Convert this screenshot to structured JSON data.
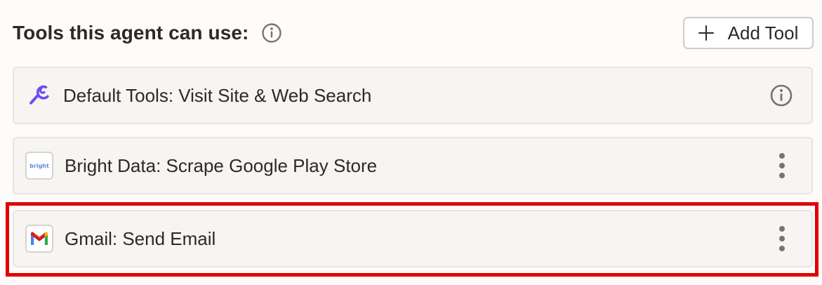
{
  "header": {
    "title": "Tools this agent can use:",
    "info_icon": "info-icon",
    "add_tool_label": "Add Tool"
  },
  "tools": [
    {
      "label": "Default Tools: Visit Site & Web Search",
      "icon": "wrench-icon",
      "action_icon": "info-icon",
      "icon_color": "#6b4cf5"
    },
    {
      "label": "Bright Data: Scrape Google Play Store",
      "icon": "bright-data-logo",
      "icon_text": "bright",
      "action_icon": "more-vertical-icon"
    },
    {
      "label": "Gmail: Send Email",
      "icon": "gmail-logo",
      "action_icon": "more-vertical-icon",
      "highlighted": true
    }
  ],
  "colors": {
    "highlight": "#e00000",
    "accent": "#6b4cf5",
    "row_background": "#f7f5f1"
  }
}
